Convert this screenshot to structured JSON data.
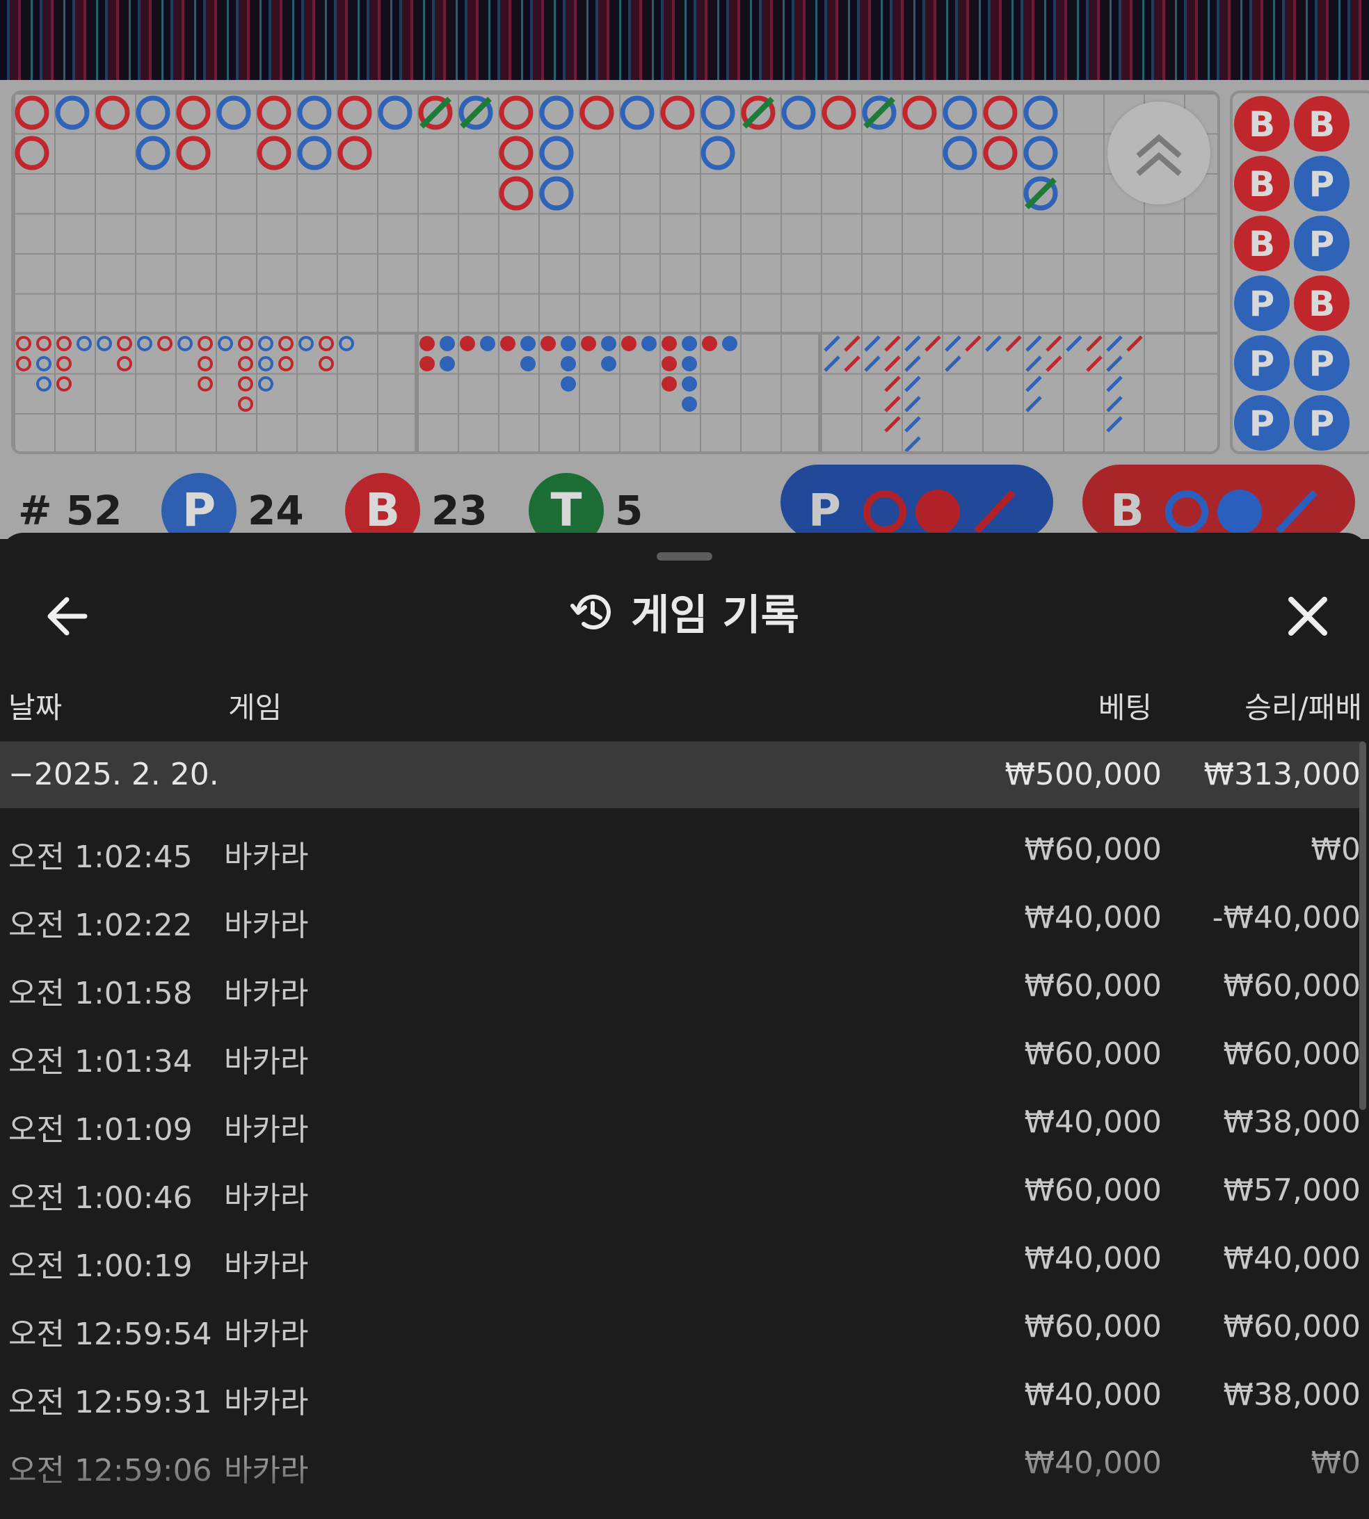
{
  "stats": {
    "round_label": "# 52",
    "player_badge": "P",
    "player_count": "24",
    "banker_badge": "B",
    "banker_count": "23",
    "tie_badge": "T",
    "tie_count": "5"
  },
  "predict": {
    "player_label": "P",
    "banker_label": "B"
  },
  "colors": {
    "banker": "#c0272d",
    "player": "#2f63b8",
    "tie": "#1f7a3a",
    "sheet_bg": "#1c1c1c",
    "date_row_bg": "#3a3a3a"
  },
  "icons": {
    "back": "arrow-left-icon",
    "history": "history-icon",
    "close": "close-icon",
    "scroll_up": "double-chevron-up-icon"
  },
  "header": {
    "title": "게임 기록"
  },
  "columns": {
    "date": "날짜",
    "game": "게임",
    "bet": "베팅",
    "result": "승리/패배"
  },
  "date_group": {
    "label": "−2025. 2. 20.",
    "bet_total": "₩500,000",
    "result_total": "₩313,000"
  },
  "rows": [
    {
      "time": "오전 1:02:45",
      "game": "바카라",
      "bet": "₩60,000",
      "result": "₩0"
    },
    {
      "time": "오전 1:02:22",
      "game": "바카라",
      "bet": "₩40,000",
      "result": "-₩40,000"
    },
    {
      "time": "오전 1:01:58",
      "game": "바카라",
      "bet": "₩60,000",
      "result": "₩60,000"
    },
    {
      "time": "오전 1:01:34",
      "game": "바카라",
      "bet": "₩60,000",
      "result": "₩60,000"
    },
    {
      "time": "오전 1:01:09",
      "game": "바카라",
      "bet": "₩40,000",
      "result": "₩38,000"
    },
    {
      "time": "오전 1:00:46",
      "game": "바카라",
      "bet": "₩60,000",
      "result": "₩57,000"
    },
    {
      "time": "오전 1:00:19",
      "game": "바카라",
      "bet": "₩40,000",
      "result": "₩40,000"
    },
    {
      "time": "오전 12:59:54",
      "game": "바카라",
      "bet": "₩60,000",
      "result": "₩60,000"
    },
    {
      "time": "오전 12:59:31",
      "game": "바카라",
      "bet": "₩40,000",
      "result": "₩38,000"
    },
    {
      "time": "오전 12:59:06",
      "game": "바카라",
      "bet": "₩40,000",
      "result": "₩0"
    }
  ],
  "big_road": [
    [
      "B",
      "B"
    ],
    [
      "P"
    ],
    [
      "B"
    ],
    [
      "P",
      "P"
    ],
    [
      "B",
      "B"
    ],
    [
      "P"
    ],
    [
      "B",
      "B"
    ],
    [
      "P",
      "P"
    ],
    [
      "B",
      "B"
    ],
    [
      "P"
    ],
    [
      "BT"
    ],
    [
      "PT"
    ],
    [
      "B",
      "B",
      "B"
    ],
    [
      "P",
      "P",
      "P"
    ],
    [
      "B"
    ],
    [
      "P"
    ],
    [
      "B"
    ],
    [
      "P",
      "P"
    ],
    [
      "BT"
    ],
    [
      "P"
    ],
    [
      "B"
    ],
    [
      "PT"
    ],
    [
      "B"
    ],
    [
      "P",
      "P"
    ],
    [
      "B",
      "B"
    ],
    [
      "P",
      "P",
      "PT"
    ]
  ],
  "bead_plate": [
    [
      "B",
      "B"
    ],
    [
      "B",
      "P"
    ],
    [
      "B",
      "P"
    ],
    [
      "P",
      "B"
    ],
    [
      "P",
      "P"
    ],
    [
      "P",
      "P"
    ]
  ]
}
